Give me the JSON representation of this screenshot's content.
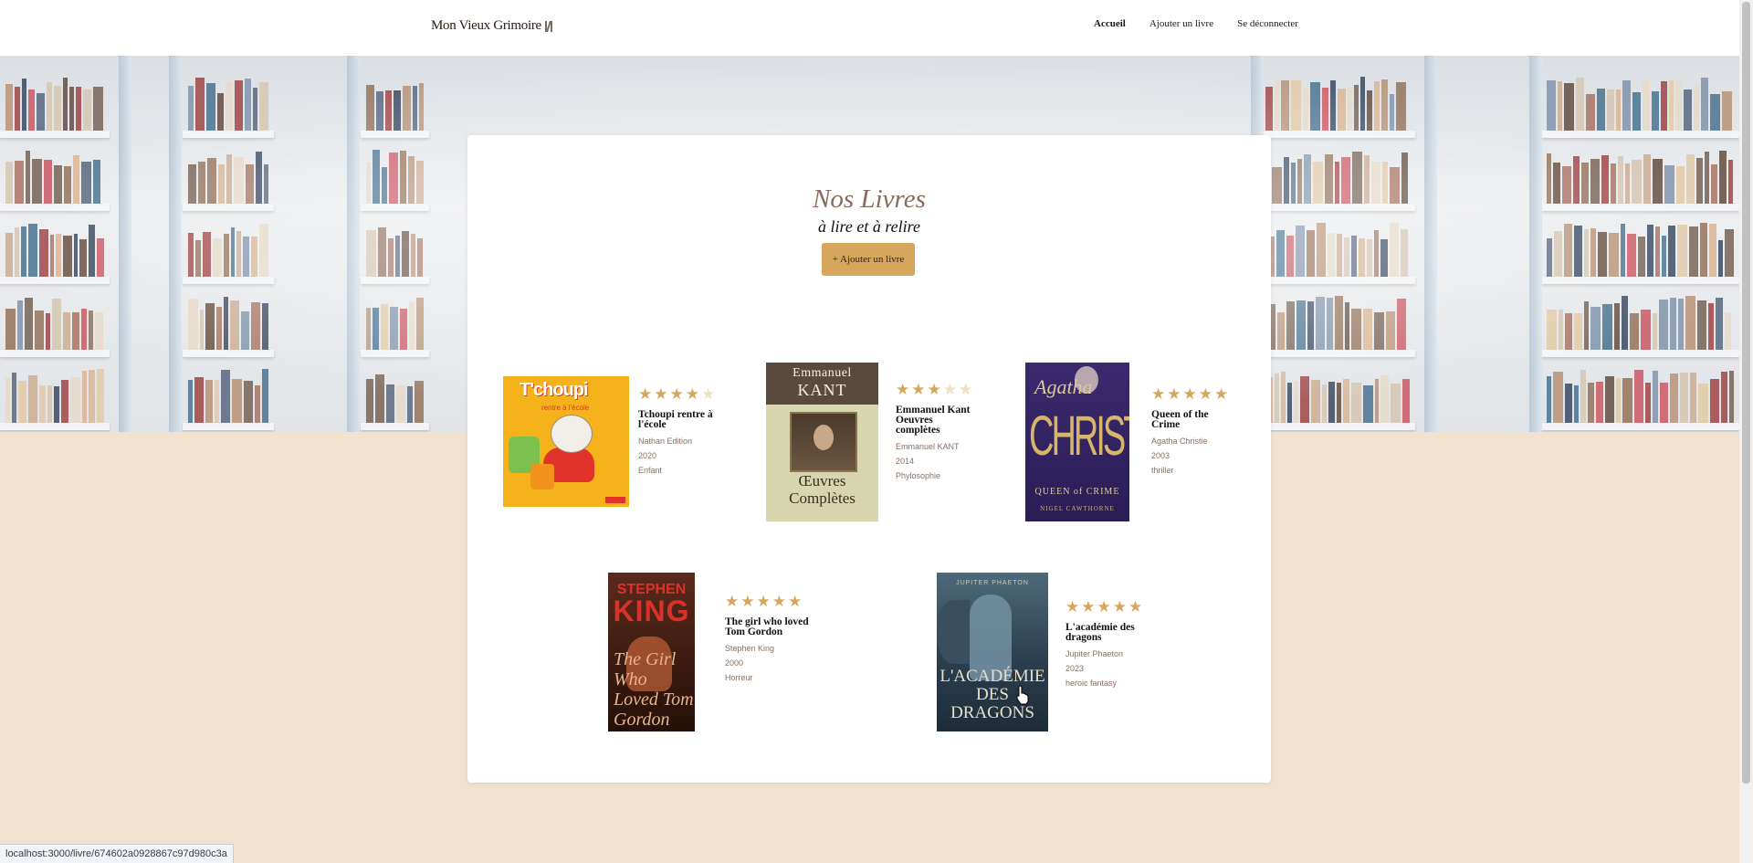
{
  "header": {
    "logo_text": "Mon Vieux Grimoire",
    "nav": [
      {
        "label": "Accueil",
        "active": true
      },
      {
        "label": "Ajouter un livre",
        "active": false
      },
      {
        "label": "Se déconnecter",
        "active": false
      }
    ]
  },
  "main": {
    "title": "Nos Livres",
    "subtitle": "à lire et à relire",
    "add_button_label": "+ Ajouter un livre",
    "books": [
      {
        "title": "Tchoupi rentre à l'école",
        "author": "Nathan Edition",
        "year": "2020",
        "genre": "Enfant",
        "rating": 4,
        "cover": {
          "line1": "T'choupi",
          "line2": "rentre à l'école"
        }
      },
      {
        "title": "Emmanuel Kant Oeuvres complètes",
        "author": "Emmanuel KANT",
        "year": "2014",
        "genre": "Phylosophie",
        "rating": 3,
        "cover": {
          "line1": "Emmanuel",
          "line2": "KANT",
          "line3": "Œuvres Complètes"
        }
      },
      {
        "title": "Queen of the Crime",
        "author": "Agatha Christie",
        "year": "2003",
        "genre": "thriller",
        "rating": 5,
        "cover": {
          "line1": "Agatha",
          "line2": "CHRISTIE",
          "line3": "QUEEN of CRIME",
          "line4": "NIGEL CAWTHORNE"
        }
      },
      {
        "title": "The girl who loved Tom Gordon",
        "author": "Stephen King",
        "year": "2000",
        "genre": "Horreur",
        "rating": 5,
        "cover": {
          "line1": "STEPHEN",
          "line2": "KING",
          "line3": "The Girl Who Loved Tom Gordon"
        }
      },
      {
        "title": "L'académie des dragons",
        "author": "Jupiter Phaeton",
        "year": "2023",
        "genre": "heroic fantasy",
        "rating": 5,
        "cover": {
          "line1": "JUPITER PHAETON",
          "line2": "L'ACADÉMIE DES DRAGONS"
        }
      }
    ]
  },
  "status_bar": {
    "url": "localhost:3000/livre/674602a0928867c97d980c3a"
  },
  "colors": {
    "accent": "#d6a65c",
    "page_bg": "#f1e2cd",
    "title": "#8a6a5c",
    "star_empty": "#efe0c4"
  }
}
